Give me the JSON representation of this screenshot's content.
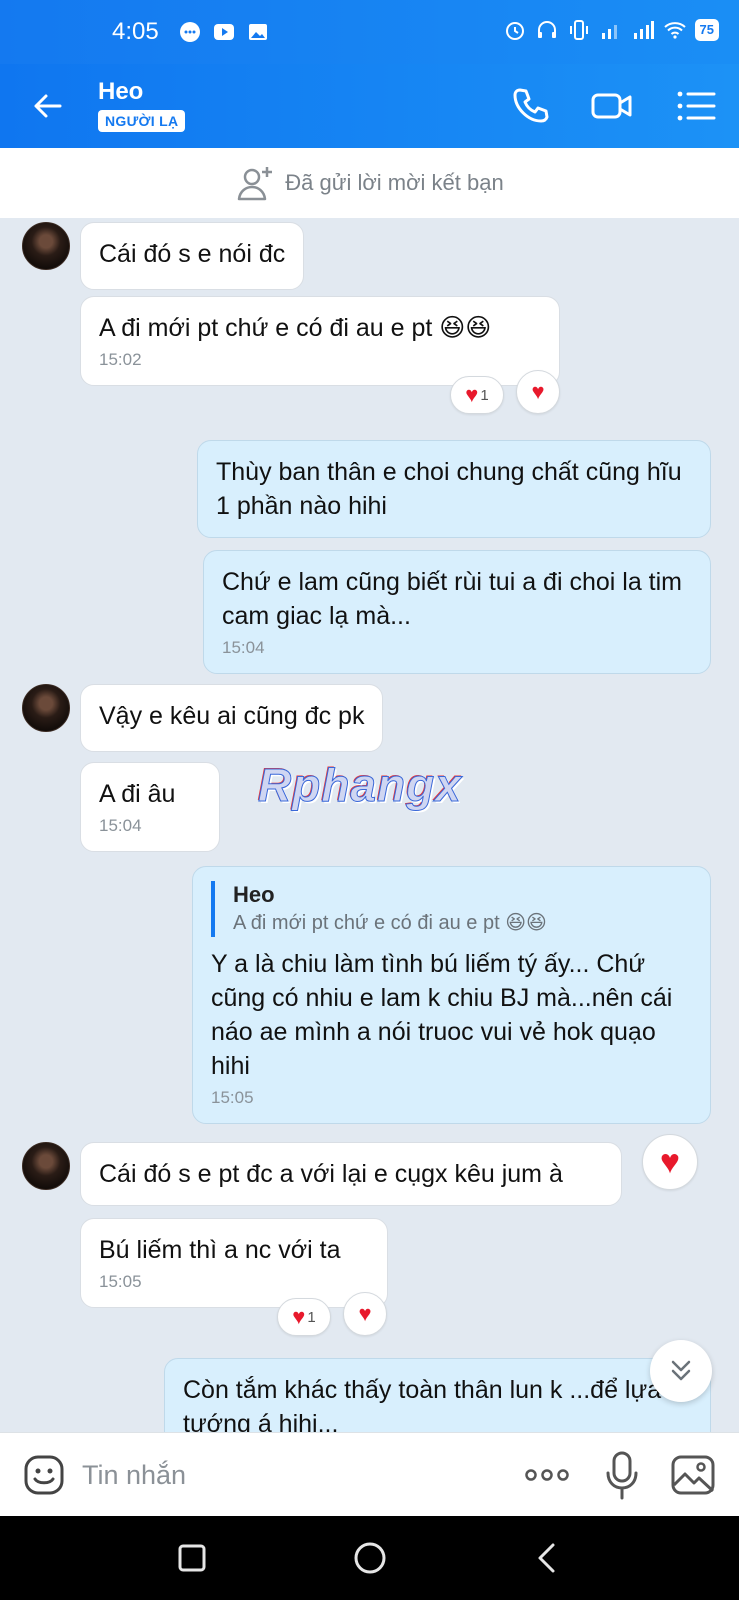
{
  "status_bar": {
    "time": "4:05",
    "battery": "75"
  },
  "header": {
    "contact_name": "Heo",
    "badge": "NGƯỜI LẠ",
    "icons": [
      "back-arrow-icon",
      "phone-icon",
      "video-camera-icon",
      "menu-list-icon"
    ]
  },
  "friend_bar": {
    "text": "Đã gửi lời mời kết bạn"
  },
  "messages": [
    {
      "dir": "in",
      "text": "Cái đó s e nói đc"
    },
    {
      "dir": "in",
      "text": "A đi mới pt chứ e có đi au e pt 😆😆",
      "time": "15:02",
      "reactions": {
        "count": "1"
      }
    },
    {
      "dir": "out",
      "text": "Thùy ban thân e choi chung chất cũng hĩu 1 phần nào hihi"
    },
    {
      "dir": "out",
      "text": "Chứ e lam cũng biết rùi tui a đi choi la tim cam giac lạ mà...",
      "time": "15:04"
    },
    {
      "dir": "in",
      "text": "Vậy e kêu ai cũng đc pk"
    },
    {
      "dir": "in",
      "text": "A đi âu",
      "time": "15:04"
    },
    {
      "dir": "out",
      "quote": {
        "name": "Heo",
        "text": "A đi mới pt chứ e có đi au e pt 😆😆"
      },
      "text": "Y a là chiu làm tình bú liếm tý ấy... Chứ cũng có nhiu e lam k chiu BJ mà...nên cái náo ae mình a nói truoc vui vẻ hok quạo hihi",
      "time": "15:05"
    },
    {
      "dir": "in",
      "text": "Cái đó s e pt đc a với lại e cụgx kêu jum à"
    },
    {
      "dir": "in",
      "text": "Bú liếm thì a nc với ta",
      "time": "15:05",
      "reactions": {
        "count": "1"
      }
    },
    {
      "dir": "out",
      "text": "Còn tắm khác thấy toàn thân lun k ...để lựa tướng á hihi..."
    }
  ],
  "watermark": "Rphangx",
  "input": {
    "placeholder": "Tin nhắn"
  },
  "colors": {
    "header": "#1479f0",
    "incoming_bubble": "#ffffff",
    "outgoing_bubble": "#d8effd",
    "heart": "#e8192c"
  }
}
